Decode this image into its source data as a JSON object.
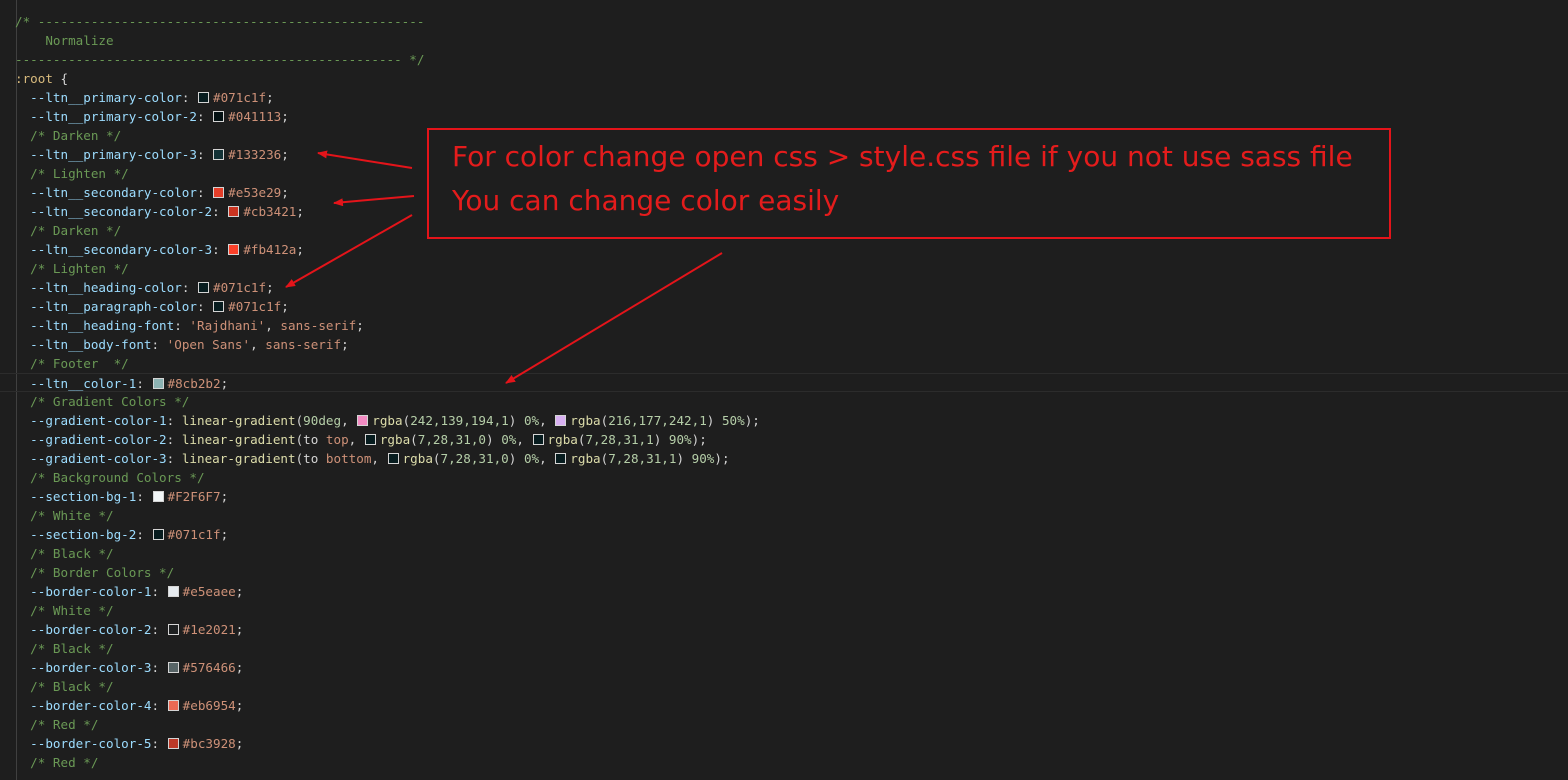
{
  "editor": {
    "lines": [
      [
        {
          "t": "/* ---------------------------------------------------",
          "c": "cm"
        }
      ],
      [
        {
          "t": "    Normalize",
          "c": "cm"
        }
      ],
      [
        {
          "t": "--------------------------------------------------- */",
          "c": "cm"
        }
      ],
      [
        {
          "t": ":root ",
          "c": "sel"
        },
        {
          "t": "{",
          "c": "pu"
        }
      ],
      [
        {
          "t": "  --ltn__primary-color",
          "c": "pr"
        },
        {
          "t": ": ",
          "c": "pu"
        },
        {
          "sw": "#071c1f"
        },
        {
          "t": "#071c1f",
          "c": "val"
        },
        {
          "t": ";",
          "c": "pu"
        }
      ],
      [
        {
          "t": "  --ltn__primary-color-2",
          "c": "pr"
        },
        {
          "t": ": ",
          "c": "pu"
        },
        {
          "sw": "#041113"
        },
        {
          "t": "#041113",
          "c": "val"
        },
        {
          "t": ";",
          "c": "pu"
        }
      ],
      [
        {
          "t": "  /* Darken */",
          "c": "cm"
        }
      ],
      [
        {
          "t": "  --ltn__primary-color-3",
          "c": "pr"
        },
        {
          "t": ": ",
          "c": "pu"
        },
        {
          "sw": "#133236"
        },
        {
          "t": "#133236",
          "c": "val"
        },
        {
          "t": ";",
          "c": "pu"
        }
      ],
      [
        {
          "t": "  /* Lighten */",
          "c": "cm"
        }
      ],
      [
        {
          "t": "  --ltn__secondary-color",
          "c": "pr"
        },
        {
          "t": ": ",
          "c": "pu"
        },
        {
          "sw": "#e53e29"
        },
        {
          "t": "#e53e29",
          "c": "val"
        },
        {
          "t": ";",
          "c": "pu"
        }
      ],
      [
        {
          "t": "  --ltn__secondary-color-2",
          "c": "pr"
        },
        {
          "t": ": ",
          "c": "pu"
        },
        {
          "sw": "#cb3421"
        },
        {
          "t": "#cb3421",
          "c": "val"
        },
        {
          "t": ";",
          "c": "pu"
        }
      ],
      [
        {
          "t": "  /* Darken */",
          "c": "cm"
        }
      ],
      [
        {
          "t": "  --ltn__secondary-color-3",
          "c": "pr"
        },
        {
          "t": ": ",
          "c": "pu"
        },
        {
          "sw": "#fb412a"
        },
        {
          "t": "#fb412a",
          "c": "val"
        },
        {
          "t": ";",
          "c": "pu"
        }
      ],
      [
        {
          "t": "  /* Lighten */",
          "c": "cm"
        }
      ],
      [
        {
          "t": "  --ltn__heading-color",
          "c": "pr"
        },
        {
          "t": ": ",
          "c": "pu"
        },
        {
          "sw": "#071c1f"
        },
        {
          "t": "#071c1f",
          "c": "val"
        },
        {
          "t": ";",
          "c": "pu"
        }
      ],
      [
        {
          "t": "  --ltn__paragraph-color",
          "c": "pr"
        },
        {
          "t": ": ",
          "c": "pu"
        },
        {
          "sw": "#071c1f"
        },
        {
          "t": "#071c1f",
          "c": "val"
        },
        {
          "t": ";",
          "c": "pu"
        }
      ],
      [
        {
          "t": "  --ltn__heading-font",
          "c": "pr"
        },
        {
          "t": ": ",
          "c": "pu"
        },
        {
          "t": "'Rajdhani'",
          "c": "val"
        },
        {
          "t": ", ",
          "c": "pu"
        },
        {
          "t": "sans-serif",
          "c": "val"
        },
        {
          "t": ";",
          "c": "pu"
        }
      ],
      [
        {
          "t": "  --ltn__body-font",
          "c": "pr"
        },
        {
          "t": ": ",
          "c": "pu"
        },
        {
          "t": "'Open Sans'",
          "c": "val"
        },
        {
          "t": ", ",
          "c": "pu"
        },
        {
          "t": "sans-serif",
          "c": "val"
        },
        {
          "t": ";",
          "c": "pu"
        }
      ],
      [
        {
          "t": "  /* Footer  */",
          "c": "cm"
        }
      ],
      [
        {
          "t": "  --ltn__color-1",
          "c": "pr"
        },
        {
          "t": ": ",
          "c": "pu"
        },
        {
          "sw": "#8cb2b2"
        },
        {
          "t": "#8cb2b2",
          "c": "val"
        },
        {
          "t": ";",
          "c": "pu"
        }
      ],
      [
        {
          "t": "  /* Gradient Colors */",
          "c": "cm"
        }
      ],
      [
        {
          "t": "  --gradient-color-1",
          "c": "pr"
        },
        {
          "t": ": ",
          "c": "pu"
        },
        {
          "t": "linear-gradient",
          "c": "fn"
        },
        {
          "t": "(",
          "c": "pu"
        },
        {
          "t": "90deg",
          "c": "num"
        },
        {
          "t": ", ",
          "c": "pu"
        },
        {
          "sw": "#f28bc2"
        },
        {
          "t": "rgba",
          "c": "fn"
        },
        {
          "t": "(",
          "c": "pu"
        },
        {
          "t": "242,139,194,1",
          "c": "num"
        },
        {
          "t": ") ",
          "c": "pu"
        },
        {
          "t": "0%",
          "c": "num"
        },
        {
          "t": ", ",
          "c": "pu"
        },
        {
          "sw": "#d8b1f2"
        },
        {
          "t": "rgba",
          "c": "fn"
        },
        {
          "t": "(",
          "c": "pu"
        },
        {
          "t": "216,177,242,1",
          "c": "num"
        },
        {
          "t": ") ",
          "c": "pu"
        },
        {
          "t": "50%",
          "c": "num"
        },
        {
          "t": ");",
          "c": "pu"
        }
      ],
      [
        {
          "t": "  --gradient-color-2",
          "c": "pr"
        },
        {
          "t": ": ",
          "c": "pu"
        },
        {
          "t": "linear-gradient",
          "c": "fn"
        },
        {
          "t": "(",
          "c": "pu"
        },
        {
          "t": "to ",
          "c": "pu"
        },
        {
          "t": "top",
          "c": "val"
        },
        {
          "t": ", ",
          "c": "pu"
        },
        {
          "sw": "#071c1f"
        },
        {
          "t": "rgba",
          "c": "fn"
        },
        {
          "t": "(",
          "c": "pu"
        },
        {
          "t": "7,28,31,0",
          "c": "num"
        },
        {
          "t": ") ",
          "c": "pu"
        },
        {
          "t": "0%",
          "c": "num"
        },
        {
          "t": ", ",
          "c": "pu"
        },
        {
          "sw": "#071c1f"
        },
        {
          "t": "rgba",
          "c": "fn"
        },
        {
          "t": "(",
          "c": "pu"
        },
        {
          "t": "7,28,31,1",
          "c": "num"
        },
        {
          "t": ") ",
          "c": "pu"
        },
        {
          "t": "90%",
          "c": "num"
        },
        {
          "t": ");",
          "c": "pu"
        }
      ],
      [
        {
          "t": "  --gradient-color-3",
          "c": "pr"
        },
        {
          "t": ": ",
          "c": "pu"
        },
        {
          "t": "linear-gradient",
          "c": "fn"
        },
        {
          "t": "(",
          "c": "pu"
        },
        {
          "t": "to ",
          "c": "pu"
        },
        {
          "t": "bottom",
          "c": "val"
        },
        {
          "t": ", ",
          "c": "pu"
        },
        {
          "sw": "#071c1f"
        },
        {
          "t": "rgba",
          "c": "fn"
        },
        {
          "t": "(",
          "c": "pu"
        },
        {
          "t": "7,28,31,0",
          "c": "num"
        },
        {
          "t": ") ",
          "c": "pu"
        },
        {
          "t": "0%",
          "c": "num"
        },
        {
          "t": ", ",
          "c": "pu"
        },
        {
          "sw": "#071c1f"
        },
        {
          "t": "rgba",
          "c": "fn"
        },
        {
          "t": "(",
          "c": "pu"
        },
        {
          "t": "7,28,31,1",
          "c": "num"
        },
        {
          "t": ") ",
          "c": "pu"
        },
        {
          "t": "90%",
          "c": "num"
        },
        {
          "t": ");",
          "c": "pu"
        }
      ],
      [
        {
          "t": "  /* Background Colors */",
          "c": "cm"
        }
      ],
      [
        {
          "t": "  --section-bg-1",
          "c": "pr"
        },
        {
          "t": ": ",
          "c": "pu"
        },
        {
          "sw": "#F2F6F7"
        },
        {
          "t": "#F2F6F7",
          "c": "val"
        },
        {
          "t": ";",
          "c": "pu"
        }
      ],
      [
        {
          "t": "  /* White */",
          "c": "cm"
        }
      ],
      [
        {
          "t": "  --section-bg-2",
          "c": "pr"
        },
        {
          "t": ": ",
          "c": "pu"
        },
        {
          "sw": "#071c1f"
        },
        {
          "t": "#071c1f",
          "c": "val"
        },
        {
          "t": ";",
          "c": "pu"
        }
      ],
      [
        {
          "t": "  /* Black */",
          "c": "cm"
        }
      ],
      [
        {
          "t": "  /* Border Colors */",
          "c": "cm"
        }
      ],
      [
        {
          "t": "  --border-color-1",
          "c": "pr"
        },
        {
          "t": ": ",
          "c": "pu"
        },
        {
          "sw": "#e5eaee"
        },
        {
          "t": "#e5eaee",
          "c": "val"
        },
        {
          "t": ";",
          "c": "pu"
        }
      ],
      [
        {
          "t": "  /* White */",
          "c": "cm"
        }
      ],
      [
        {
          "t": "  --border-color-2",
          "c": "pr"
        },
        {
          "t": ": ",
          "c": "pu"
        },
        {
          "sw": "#1e2021"
        },
        {
          "t": "#1e2021",
          "c": "val"
        },
        {
          "t": ";",
          "c": "pu"
        }
      ],
      [
        {
          "t": "  /* Black */",
          "c": "cm"
        }
      ],
      [
        {
          "t": "  --border-color-3",
          "c": "pr"
        },
        {
          "t": ": ",
          "c": "pu"
        },
        {
          "sw": "#576466"
        },
        {
          "t": "#576466",
          "c": "val"
        },
        {
          "t": ";",
          "c": "pu"
        }
      ],
      [
        {
          "t": "  /* Black */",
          "c": "cm"
        }
      ],
      [
        {
          "t": "  --border-color-4",
          "c": "pr"
        },
        {
          "t": ": ",
          "c": "pu"
        },
        {
          "sw": "#eb6954"
        },
        {
          "t": "#eb6954",
          "c": "val"
        },
        {
          "t": ";",
          "c": "pu"
        }
      ],
      [
        {
          "t": "  /* Red */",
          "c": "cm"
        }
      ],
      [
        {
          "t": "  --border-color-5",
          "c": "pr"
        },
        {
          "t": ": ",
          "c": "pu"
        },
        {
          "sw": "#bc3928"
        },
        {
          "t": "#bc3928",
          "c": "val"
        },
        {
          "t": ";",
          "c": "pu"
        }
      ],
      [
        {
          "t": "  /* Red */",
          "c": "cm"
        }
      ]
    ],
    "current_line": 19
  },
  "annotation": {
    "line1": "For color change open css > style.css file if you not use sass file",
    "line2": "You can change color easily",
    "color": "#e41c1c"
  }
}
